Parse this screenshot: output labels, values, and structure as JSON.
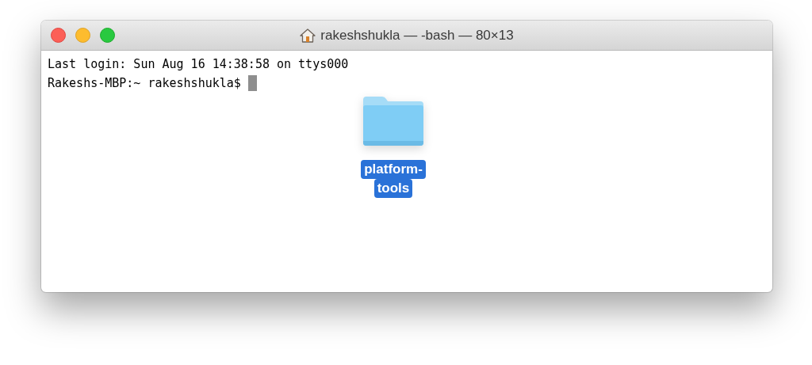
{
  "window": {
    "title": "rakeshshukla — -bash — 80×13"
  },
  "terminal": {
    "lines": [
      "Last login: Sun Aug 16 14:38:58 on ttys000",
      "Rakeshs-MBP:~ rakeshshukla$"
    ]
  },
  "dragged_item": {
    "label_lines": [
      "platform-",
      "tools"
    ],
    "selected": true
  }
}
